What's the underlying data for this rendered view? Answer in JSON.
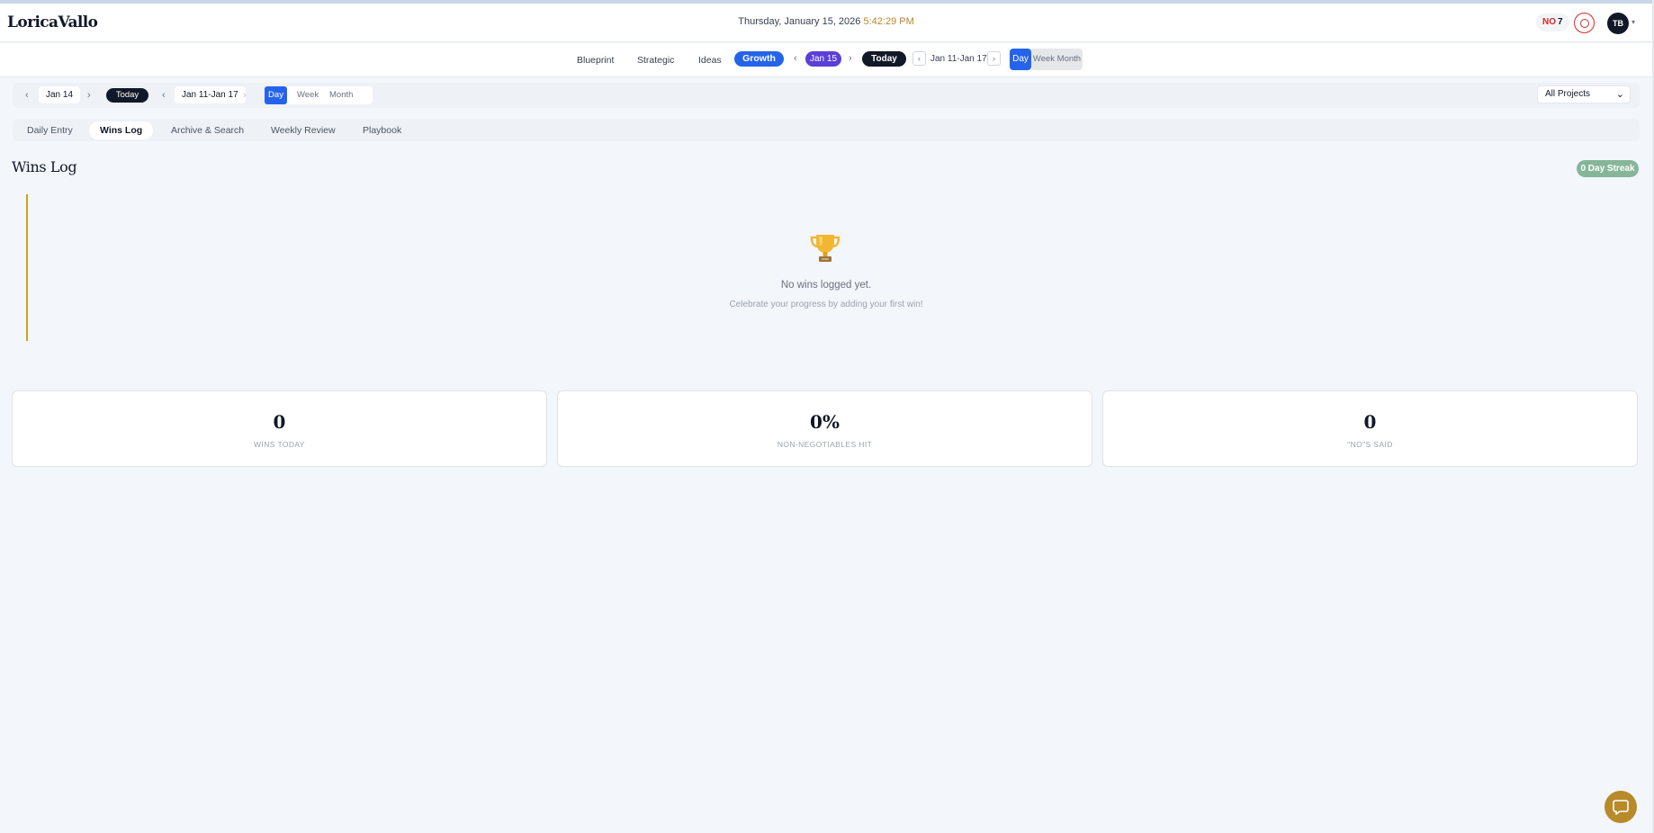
{
  "header": {
    "logo": "LoricaVallo",
    "date_text": "Thursday, January 15, 2026",
    "time_text": "5:42:29 PM",
    "no_label": "NO",
    "no_count": "7",
    "avatar_initials": "TB"
  },
  "main_nav": {
    "items": [
      "Blueprint",
      "Strategic",
      "Ideas",
      "Growth"
    ],
    "active": "Growth",
    "date_pill": "Jan 15",
    "today_label": "Today",
    "range": "Jan 11-Jan 17",
    "views": {
      "day": "Day",
      "rest": "Week Month"
    }
  },
  "sub_nav": {
    "day": "Jan 14",
    "today_label": "Today",
    "range": "Jan 11-Jan 17",
    "views": [
      "Day",
      "Week",
      "Month"
    ],
    "projects": "All Projects"
  },
  "tabs": [
    "Daily Entry",
    "Wins Log",
    "Archive & Search",
    "Weekly Review",
    "Playbook"
  ],
  "active_tab": "Wins Log",
  "page": {
    "title": "Wins Log",
    "streak": "0 Day Streak",
    "empty_title": "No wins logged yet.",
    "empty_subtitle": "Celebrate your progress by adding your first win!"
  },
  "stats": [
    {
      "value": "0",
      "label": "WINS TODAY"
    },
    {
      "value": "0%",
      "label": "NON-NEGOTIABLES HIT"
    },
    {
      "value": "0",
      "label": "\"NO\"S SAID"
    }
  ],
  "colors": {
    "accent_blue": "#2563eb",
    "accent_purple": "#5b3fd8",
    "gold": "#b88a2a",
    "streak_green": "#86b69a",
    "alert_red": "#dc2626"
  },
  "icons": [
    "target-icon",
    "trophy-icon",
    "help-chat-icon",
    "chevron-left-icon",
    "chevron-right-icon",
    "chevron-down-icon"
  ]
}
